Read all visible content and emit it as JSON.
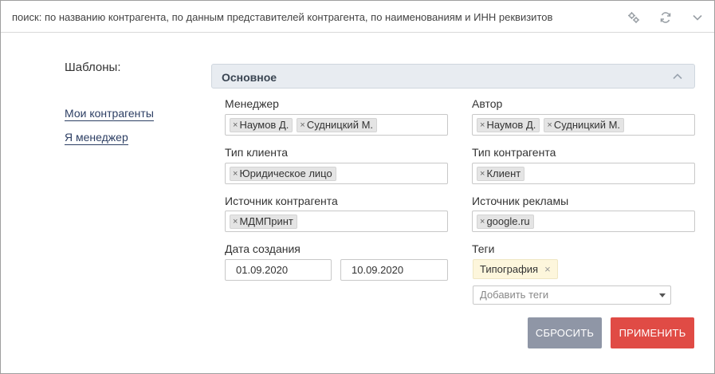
{
  "search": {
    "placeholder": "поиск: по названию контрагента, по данным представителей контрагента, по наименованиям и ИНН реквизитов"
  },
  "sidebar": {
    "title": "Шаблоны:",
    "links": [
      "Мои контрагенты",
      "Я менеджер"
    ]
  },
  "section": {
    "title": "Основное"
  },
  "fields": {
    "manager": {
      "label": "Менеджер",
      "chips": [
        "Наумов Д.",
        "Судницкий М."
      ]
    },
    "author": {
      "label": "Автор",
      "chips": [
        "Наумов Д.",
        "Судницкий М."
      ]
    },
    "client_type": {
      "label": "Тип клиента",
      "chips": [
        "Юридическое лицо"
      ]
    },
    "counterparty_type": {
      "label": "Тип контрагента",
      "chips": [
        "Клиент"
      ]
    },
    "counterparty_source": {
      "label": "Источник контрагента",
      "chips": [
        "МДМПринт"
      ]
    },
    "ad_source": {
      "label": "Источник рекламы",
      "chips": [
        "google.ru"
      ]
    },
    "created": {
      "label": "Дата создания",
      "from": "01.09.2020",
      "to": "10.09.2020"
    },
    "tags": {
      "label": "Теги",
      "items": [
        "Типография"
      ],
      "add_placeholder": "Добавить теги"
    }
  },
  "chip_remove_glyph": "×",
  "buttons": {
    "reset": "СБРОСИТЬ",
    "apply": "ПРИМЕНИТЬ"
  },
  "colors": {
    "apply": "#e04b45",
    "reset": "#8f96a6",
    "section_header": "#e8ecf1",
    "tag_pill": "#fdf6dc",
    "link": "#2c3e63"
  },
  "icons": {
    "toolbar": [
      "settings-icon",
      "refresh-icon",
      "chevron-down-icon"
    ]
  }
}
